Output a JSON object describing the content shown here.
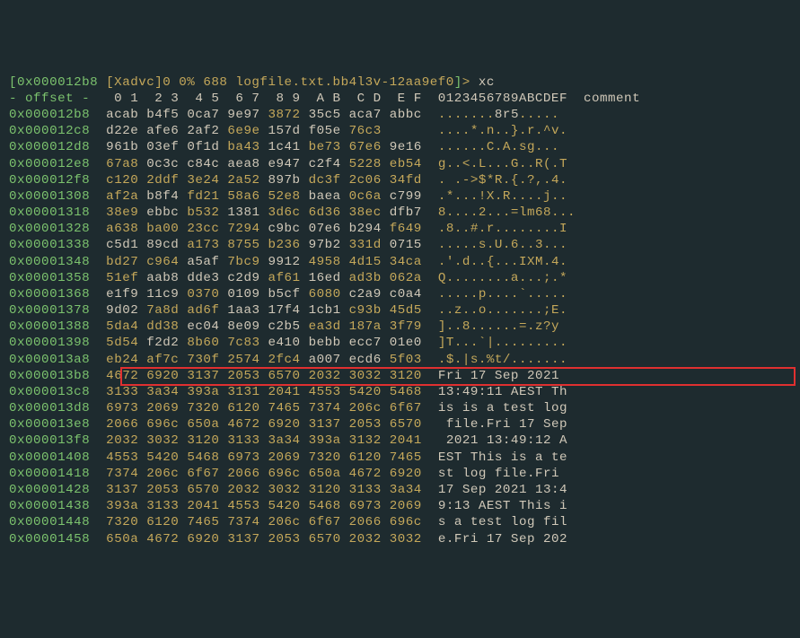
{
  "prompt": {
    "lbracket": "[",
    "addr": "0x000012b8",
    "mid": " [Xadvc]0 0% 688 logfile.txt.bb4l3v-12aa9ef0",
    "rbracket": "]",
    "gt": "> ",
    "cmd": "xc"
  },
  "header": {
    "left": "- offset -  ",
    "cols": " 0 1  2 3  4 5  6 7  8 9  A B  C D  E F  0123456789ABCDEF  comment"
  },
  "rows": [
    {
      "addr": "0x000012b8",
      "hex": [
        [
          "acab",
          "w"
        ],
        [
          "b4f5",
          "w"
        ],
        [
          "0ca7",
          "w"
        ],
        [
          "9e97",
          "w"
        ],
        [
          "3872",
          "y"
        ],
        [
          "35c5",
          "w"
        ],
        [
          "aca7",
          "w"
        ],
        [
          "abbc",
          "w"
        ]
      ],
      "ascii": [
        ".......",
        "8r5",
        "....."
      ],
      "cls": [
        "y",
        "w",
        "y"
      ]
    },
    {
      "addr": "0x000012c8",
      "hex": [
        [
          "d22e",
          "w"
        ],
        [
          "afe6",
          "w"
        ],
        [
          "2af2",
          "w"
        ],
        [
          "6e9e",
          "y"
        ],
        [
          "157d",
          "w"
        ],
        [
          "f05e",
          "w"
        ],
        [
          "76c3",
          "y"
        ],
        [
          "    ",
          "w"
        ]
      ],
      "ascii": [
        "....*.n..}.r.^v."
      ],
      "cls": [
        "y"
      ]
    },
    {
      "addr": "0x000012d8",
      "hex": [
        [
          "961b",
          "w"
        ],
        [
          "03ef",
          "w"
        ],
        [
          "0f1d",
          "w"
        ],
        [
          "ba43",
          "y"
        ],
        [
          "1c41",
          "w"
        ],
        [
          "be73",
          "y"
        ],
        [
          "67e6",
          "y"
        ],
        [
          "9e16",
          "w"
        ]
      ],
      "ascii": [
        "......C.A.sg..."
      ],
      "cls": [
        "y"
      ]
    },
    {
      "addr": "0x000012e8",
      "hex": [
        [
          "67a8",
          "y"
        ],
        [
          "0c3c",
          "w"
        ],
        [
          "c84c",
          "w"
        ],
        [
          "aea8",
          "w"
        ],
        [
          "e947",
          "w"
        ],
        [
          "c2f4",
          "w"
        ],
        [
          "5228",
          "y"
        ],
        [
          "eb54",
          "y"
        ]
      ],
      "ascii": [
        "g..<.L...G..R(.T"
      ],
      "cls": [
        "y"
      ]
    },
    {
      "addr": "0x000012f8",
      "hex": [
        [
          "c120",
          "y"
        ],
        [
          "2ddf",
          "y"
        ],
        [
          "3e24",
          "y"
        ],
        [
          "2a52",
          "y"
        ],
        [
          "897b",
          "w"
        ],
        [
          "dc3f",
          "y"
        ],
        [
          "2c06",
          "y"
        ],
        [
          "34fd",
          "y"
        ]
      ],
      "ascii": [
        ". .->$*R.{.?,.4."
      ],
      "cls": [
        "y"
      ]
    },
    {
      "addr": "0x00001308",
      "hex": [
        [
          "af2a",
          "y"
        ],
        [
          "b8f4",
          "w"
        ],
        [
          "fd21",
          "y"
        ],
        [
          "58a6",
          "y"
        ],
        [
          "52e8",
          "y"
        ],
        [
          "baea",
          "w"
        ],
        [
          "0c6a",
          "y"
        ],
        [
          "c799",
          "w"
        ]
      ],
      "ascii": [
        ".*...!X.R....j.."
      ],
      "cls": [
        "y"
      ]
    },
    {
      "addr": "0x00001318",
      "hex": [
        [
          "38e9",
          "y"
        ],
        [
          "ebbc",
          "w"
        ],
        [
          "b532",
          "y"
        ],
        [
          "1381",
          "w"
        ],
        [
          "3d6c",
          "y"
        ],
        [
          "6d36",
          "y"
        ],
        [
          "38ec",
          "y"
        ],
        [
          "dfb7",
          "w"
        ]
      ],
      "ascii": [
        "8....2...=lm68..."
      ],
      "cls": [
        "y"
      ]
    },
    {
      "addr": "0x00001328",
      "hex": [
        [
          "a638",
          "y"
        ],
        [
          "ba00",
          "y"
        ],
        [
          "23cc",
          "y"
        ],
        [
          "7294",
          "y"
        ],
        [
          "c9bc",
          "w"
        ],
        [
          "07e6",
          "w"
        ],
        [
          "b294",
          "w"
        ],
        [
          "f649",
          "y"
        ]
      ],
      "ascii": [
        ".8..#.r........I"
      ],
      "cls": [
        "y"
      ]
    },
    {
      "addr": "0x00001338",
      "hex": [
        [
          "c5d1",
          "w"
        ],
        [
          "89cd",
          "w"
        ],
        [
          "a173",
          "y"
        ],
        [
          "8755",
          "y"
        ],
        [
          "b236",
          "y"
        ],
        [
          "97b2",
          "w"
        ],
        [
          "331d",
          "y"
        ],
        [
          "0715",
          "w"
        ]
      ],
      "ascii": [
        ".....s.U.6..3..."
      ],
      "cls": [
        "y"
      ]
    },
    {
      "addr": "0x00001348",
      "hex": [
        [
          "bd27",
          "y"
        ],
        [
          "c964",
          "y"
        ],
        [
          "a5af",
          "w"
        ],
        [
          "7bc9",
          "y"
        ],
        [
          "9912",
          "w"
        ],
        [
          "4958",
          "y"
        ],
        [
          "4d15",
          "y"
        ],
        [
          "34ca",
          "y"
        ]
      ],
      "ascii": [
        ".'.d..{...IXM.4."
      ],
      "cls": [
        "y"
      ]
    },
    {
      "addr": "0x00001358",
      "hex": [
        [
          "51ef",
          "y"
        ],
        [
          "aab8",
          "w"
        ],
        [
          "dde3",
          "w"
        ],
        [
          "c2d9",
          "w"
        ],
        [
          "af61",
          "y"
        ],
        [
          "16ed",
          "w"
        ],
        [
          "ad3b",
          "y"
        ],
        [
          "062a",
          "y"
        ]
      ],
      "ascii": [
        "Q........a...;.*"
      ],
      "cls": [
        "y"
      ]
    },
    {
      "addr": "0x00001368",
      "hex": [
        [
          "e1f9",
          "w"
        ],
        [
          "11c9",
          "w"
        ],
        [
          "0370",
          "y"
        ],
        [
          "0109",
          "w"
        ],
        [
          "b5cf",
          "w"
        ],
        [
          "6080",
          "y"
        ],
        [
          "c2a9",
          "w"
        ],
        [
          "c0a4",
          "w"
        ]
      ],
      "ascii": [
        ".....p....`....."
      ],
      "cls": [
        "y"
      ]
    },
    {
      "addr": "0x00001378",
      "hex": [
        [
          "9d02",
          "w"
        ],
        [
          "7a8d",
          "y"
        ],
        [
          "ad6f",
          "y"
        ],
        [
          "1aa3",
          "w"
        ],
        [
          "17f4",
          "w"
        ],
        [
          "1cb1",
          "w"
        ],
        [
          "c93b",
          "y"
        ],
        [
          "45d5",
          "y"
        ]
      ],
      "ascii": [
        "..z..o.......;E."
      ],
      "cls": [
        "y"
      ]
    },
    {
      "addr": "0x00001388",
      "hex": [
        [
          "5da4",
          "y"
        ],
        [
          "dd38",
          "y"
        ],
        [
          "ec04",
          "w"
        ],
        [
          "8e09",
          "w"
        ],
        [
          "c2b5",
          "w"
        ],
        [
          "ea3d",
          "y"
        ],
        [
          "187a",
          "y"
        ],
        [
          "3f79",
          "y"
        ]
      ],
      "ascii": [
        "]..8......=.z?y"
      ],
      "cls": [
        "y"
      ]
    },
    {
      "addr": "0x00001398",
      "hex": [
        [
          "5d54",
          "y"
        ],
        [
          "f2d2",
          "w"
        ],
        [
          "8b60",
          "y"
        ],
        [
          "7c83",
          "y"
        ],
        [
          "e410",
          "w"
        ],
        [
          "bebb",
          "w"
        ],
        [
          "ecc7",
          "w"
        ],
        [
          "01e0",
          "w"
        ]
      ],
      "ascii": [
        "]T...`|........."
      ],
      "cls": [
        "y"
      ]
    },
    {
      "addr": "0x000013a8",
      "hex": [
        [
          "eb24",
          "y"
        ],
        [
          "af7c",
          "y"
        ],
        [
          "730f",
          "y"
        ],
        [
          "2574",
          "y"
        ],
        [
          "2fc4",
          "y"
        ],
        [
          "a007",
          "w"
        ],
        [
          "ecd6",
          "w"
        ],
        [
          "5f03",
          "y"
        ]
      ],
      "ascii": [
        ".$.|s.%t/......."
      ],
      "cls": [
        "y"
      ]
    },
    {
      "addr": "0x000013b8",
      "hex": [
        [
          "4672",
          "y"
        ],
        [
          "6920",
          "y"
        ],
        [
          "3137",
          "y"
        ],
        [
          "2053",
          "y"
        ],
        [
          "6570",
          "y"
        ],
        [
          "2032",
          "y"
        ],
        [
          "3032",
          "y"
        ],
        [
          "3120",
          "y"
        ]
      ],
      "ascii": [
        "Fri 17 Sep 2021 "
      ],
      "cls": [
        "w"
      ],
      "hl": true
    },
    {
      "addr": "0x000013c8",
      "hex": [
        [
          "3133",
          "y"
        ],
        [
          "3a34",
          "y"
        ],
        [
          "393a",
          "y"
        ],
        [
          "3131",
          "y"
        ],
        [
          "2041",
          "y"
        ],
        [
          "4553",
          "y"
        ],
        [
          "5420",
          "y"
        ],
        [
          "5468",
          "y"
        ]
      ],
      "ascii": [
        "13:49:11 AEST Th"
      ],
      "cls": [
        "w"
      ]
    },
    {
      "addr": "0x000013d8",
      "hex": [
        [
          "6973",
          "y"
        ],
        [
          "2069",
          "y"
        ],
        [
          "7320",
          "y"
        ],
        [
          "6120",
          "y"
        ],
        [
          "7465",
          "y"
        ],
        [
          "7374",
          "y"
        ],
        [
          "206c",
          "y"
        ],
        [
          "6f67",
          "y"
        ]
      ],
      "ascii": [
        "is is a test log"
      ],
      "cls": [
        "w"
      ]
    },
    {
      "addr": "0x000013e8",
      "hex": [
        [
          "2066",
          "y"
        ],
        [
          "696c",
          "y"
        ],
        [
          "650a",
          "y"
        ],
        [
          "4672",
          "y"
        ],
        [
          "6920",
          "y"
        ],
        [
          "3137",
          "y"
        ],
        [
          "2053",
          "y"
        ],
        [
          "6570",
          "y"
        ]
      ],
      "ascii": [
        " file.Fri 17 Sep"
      ],
      "cls": [
        "w"
      ]
    },
    {
      "addr": "0x000013f8",
      "hex": [
        [
          "2032",
          "y"
        ],
        [
          "3032",
          "y"
        ],
        [
          "3120",
          "y"
        ],
        [
          "3133",
          "y"
        ],
        [
          "3a34",
          "y"
        ],
        [
          "393a",
          "y"
        ],
        [
          "3132",
          "y"
        ],
        [
          "2041",
          "y"
        ]
      ],
      "ascii": [
        " 2021 13:49:12 A"
      ],
      "cls": [
        "w"
      ]
    },
    {
      "addr": "0x00001408",
      "hex": [
        [
          "4553",
          "y"
        ],
        [
          "5420",
          "y"
        ],
        [
          "5468",
          "y"
        ],
        [
          "6973",
          "y"
        ],
        [
          "2069",
          "y"
        ],
        [
          "7320",
          "y"
        ],
        [
          "6120",
          "y"
        ],
        [
          "7465",
          "y"
        ]
      ],
      "ascii": [
        "EST This is a te"
      ],
      "cls": [
        "w"
      ]
    },
    {
      "addr": "0x00001418",
      "hex": [
        [
          "7374",
          "y"
        ],
        [
          "206c",
          "y"
        ],
        [
          "6f67",
          "y"
        ],
        [
          "2066",
          "y"
        ],
        [
          "696c",
          "y"
        ],
        [
          "650a",
          "y"
        ],
        [
          "4672",
          "y"
        ],
        [
          "6920",
          "y"
        ]
      ],
      "ascii": [
        "st log file.Fri "
      ],
      "cls": [
        "w"
      ]
    },
    {
      "addr": "0x00001428",
      "hex": [
        [
          "3137",
          "y"
        ],
        [
          "2053",
          "y"
        ],
        [
          "6570",
          "y"
        ],
        [
          "2032",
          "y"
        ],
        [
          "3032",
          "y"
        ],
        [
          "3120",
          "y"
        ],
        [
          "3133",
          "y"
        ],
        [
          "3a34",
          "y"
        ]
      ],
      "ascii": [
        "17 Sep 2021 13:4"
      ],
      "cls": [
        "w"
      ]
    },
    {
      "addr": "0x00001438",
      "hex": [
        [
          "393a",
          "y"
        ],
        [
          "3133",
          "y"
        ],
        [
          "2041",
          "y"
        ],
        [
          "4553",
          "y"
        ],
        [
          "5420",
          "y"
        ],
        [
          "5468",
          "y"
        ],
        [
          "6973",
          "y"
        ],
        [
          "2069",
          "y"
        ]
      ],
      "ascii": [
        "9:13 AEST This i"
      ],
      "cls": [
        "w"
      ]
    },
    {
      "addr": "0x00001448",
      "hex": [
        [
          "7320",
          "y"
        ],
        [
          "6120",
          "y"
        ],
        [
          "7465",
          "y"
        ],
        [
          "7374",
          "y"
        ],
        [
          "206c",
          "y"
        ],
        [
          "6f67",
          "y"
        ],
        [
          "2066",
          "y"
        ],
        [
          "696c",
          "y"
        ]
      ],
      "ascii": [
        "s a test log fil"
      ],
      "cls": [
        "w"
      ]
    },
    {
      "addr": "0x00001458",
      "hex": [
        [
          "650a",
          "y"
        ],
        [
          "4672",
          "y"
        ],
        [
          "6920",
          "y"
        ],
        [
          "3137",
          "y"
        ],
        [
          "2053",
          "y"
        ],
        [
          "6570",
          "y"
        ],
        [
          "2032",
          "y"
        ],
        [
          "3032",
          "y"
        ]
      ],
      "ascii": [
        "e.Fri 17 Sep 202"
      ],
      "cls": [
        "w"
      ]
    }
  ]
}
